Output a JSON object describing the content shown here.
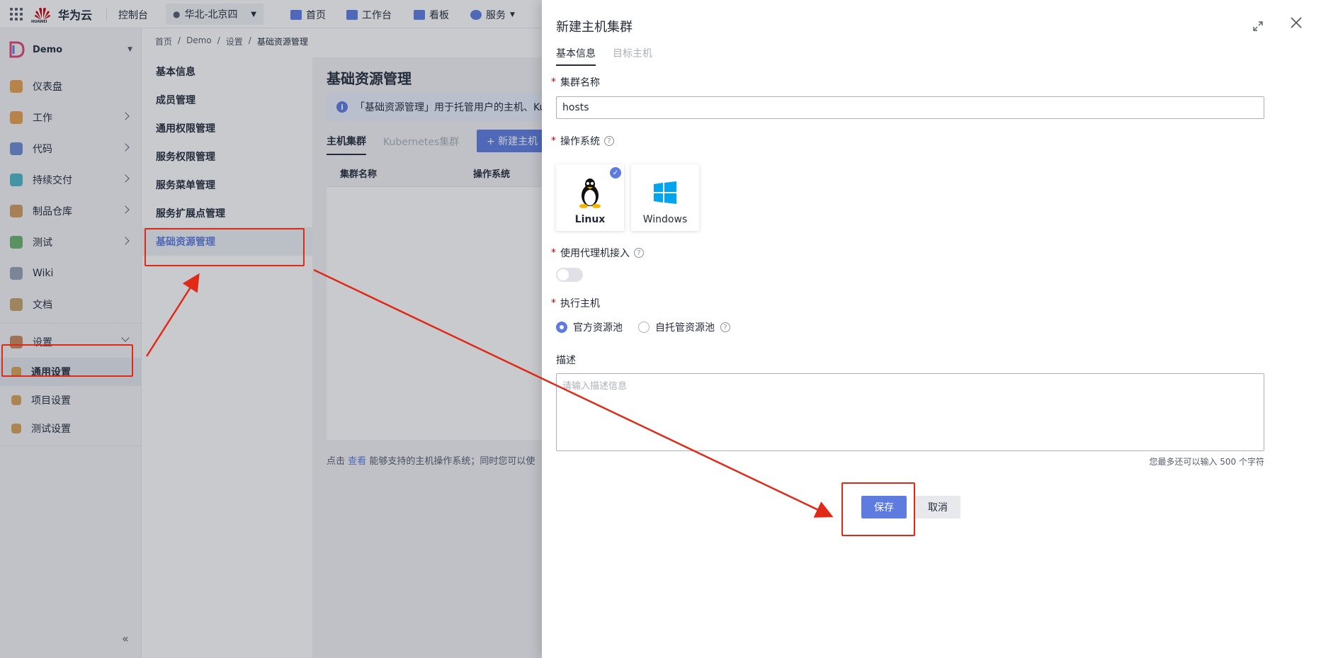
{
  "topbar": {
    "brand_small": "HUAWEI",
    "brand": "华为云",
    "console": "控制台",
    "region": "华北-北京四",
    "nav": [
      {
        "label": "首页"
      },
      {
        "label": "工作台"
      },
      {
        "label": "看板"
      },
      {
        "label": "服务"
      }
    ]
  },
  "sidebar": {
    "project": "Demo",
    "items": [
      {
        "label": "仪表盘"
      },
      {
        "label": "工作"
      },
      {
        "label": "代码"
      },
      {
        "label": "持续交付"
      },
      {
        "label": "制品仓库"
      },
      {
        "label": "测试"
      },
      {
        "label": "Wiki"
      },
      {
        "label": "文档"
      },
      {
        "label": "设置"
      }
    ],
    "sub_items": [
      {
        "label": "通用设置"
      },
      {
        "label": "项目设置"
      },
      {
        "label": "测试设置"
      }
    ],
    "collapse": "«"
  },
  "breadcrumb": [
    "首页",
    "/",
    "Demo",
    "/",
    "设置",
    "/",
    "基础资源管理"
  ],
  "settings_menu": [
    {
      "label": "基本信息"
    },
    {
      "label": "成员管理"
    },
    {
      "label": "通用权限管理"
    },
    {
      "label": "服务权限管理"
    },
    {
      "label": "服务菜单管理"
    },
    {
      "label": "服务扩展点管理"
    },
    {
      "label": "基础资源管理"
    }
  ],
  "main": {
    "title": "基础资源管理",
    "info": "「基础资源管理」用于托管用户的主机、Ku",
    "tabs": [
      {
        "label": "主机集群"
      },
      {
        "label": "Kubernetes集群"
      }
    ],
    "new_button": "+ 新建主机",
    "columns": [
      "集群名称",
      "操作系统"
    ],
    "footnote_prefix": "点击",
    "footnote_link": "查看",
    "footnote_suffix": "能够支持的主机操作系统；同时您可以使"
  },
  "drawer": {
    "title": "新建主机集群",
    "tabs": [
      {
        "label": "基本信息"
      },
      {
        "label": "目标主机"
      }
    ],
    "fields": {
      "cluster_name_label": "集群名称",
      "cluster_name_value": "hosts",
      "os_label": "操作系统",
      "os_options": [
        {
          "label": "Linux",
          "selected": true
        },
        {
          "label": "Windows",
          "selected": false
        }
      ],
      "proxy_label": "使用代理机接入",
      "exec_host_label": "执行主机",
      "exec_options": [
        {
          "label": "官方资源池",
          "selected": true
        },
        {
          "label": "自托管资源池",
          "selected": false
        }
      ],
      "desc_label": "描述",
      "desc_placeholder": "请输入描述信息",
      "counter": "您最多还可以输入 500 个字符"
    },
    "save": "保存",
    "cancel": "取消",
    "required_mark": "*",
    "help_mark": "?"
  },
  "colors": {
    "accent": "#5e7ce0",
    "annotation": "#e02a18",
    "huawei_red": "#c7000b"
  }
}
